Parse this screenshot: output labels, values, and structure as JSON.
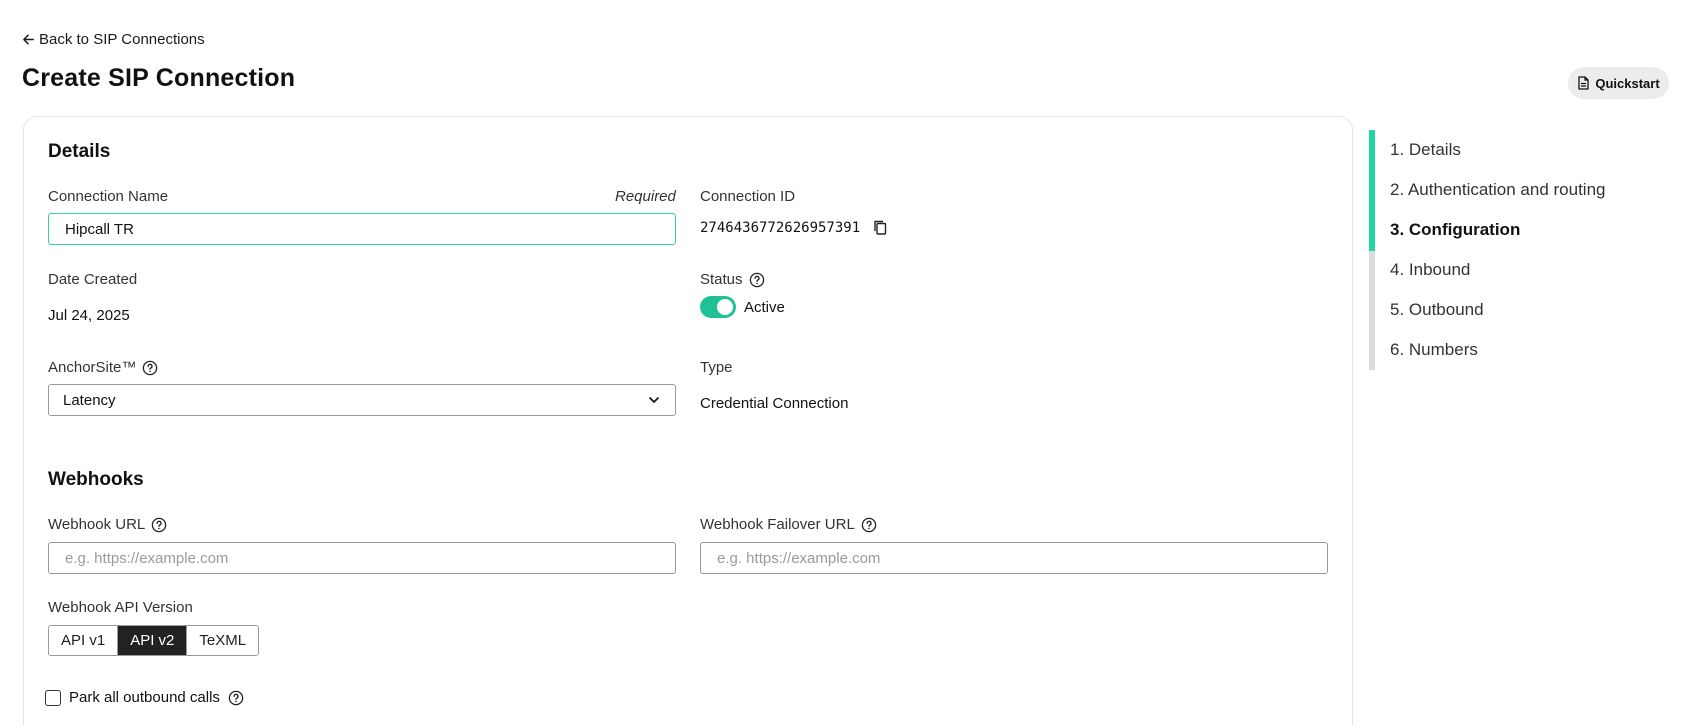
{
  "header": {
    "back_label": "Back to SIP Connections",
    "title": "Create SIP Connection",
    "quickstart_label": "Quickstart"
  },
  "details": {
    "section_title": "Details",
    "connection_name_label": "Connection Name",
    "required_label": "Required",
    "connection_name_value": "Hipcall TR",
    "connection_id_label": "Connection ID",
    "connection_id_value": "2746436772626957391",
    "date_created_label": "Date Created",
    "date_created_value": "Jul 24, 2025",
    "status_label": "Status",
    "status_value": "Active",
    "status_on": true,
    "anchorsite_label": "AnchorSite™",
    "anchorsite_value": "Latency",
    "type_label": "Type",
    "type_value": "Credential Connection"
  },
  "webhooks": {
    "section_title": "Webhooks",
    "webhook_url_label": "Webhook URL",
    "webhook_url_placeholder": "e.g. https://example.com",
    "webhook_failover_label": "Webhook Failover URL",
    "webhook_failover_placeholder": "e.g. https://example.com",
    "api_version_label": "Webhook API Version",
    "api_versions": [
      "API v1",
      "API v2",
      "TeXML"
    ],
    "api_version_selected": "API v2",
    "park_outbound_label": "Park all outbound calls",
    "park_outbound_checked": false
  },
  "stepper": {
    "steps": [
      "1. Details",
      "2. Authentication and routing",
      "3. Configuration",
      "4. Inbound",
      "5. Outbound",
      "6. Numbers"
    ],
    "current_step": 3,
    "accent_color": "#21d6a4"
  },
  "colors": {
    "accent": "#21c197",
    "focus_border": "#3ecf9e",
    "segment_active": "#222222"
  },
  "icons": {
    "back": "arrow-left-icon",
    "quickstart": "document-icon",
    "help": "question-circle-icon",
    "copy": "copy-icon",
    "dropdown": "chevron-down-icon"
  }
}
